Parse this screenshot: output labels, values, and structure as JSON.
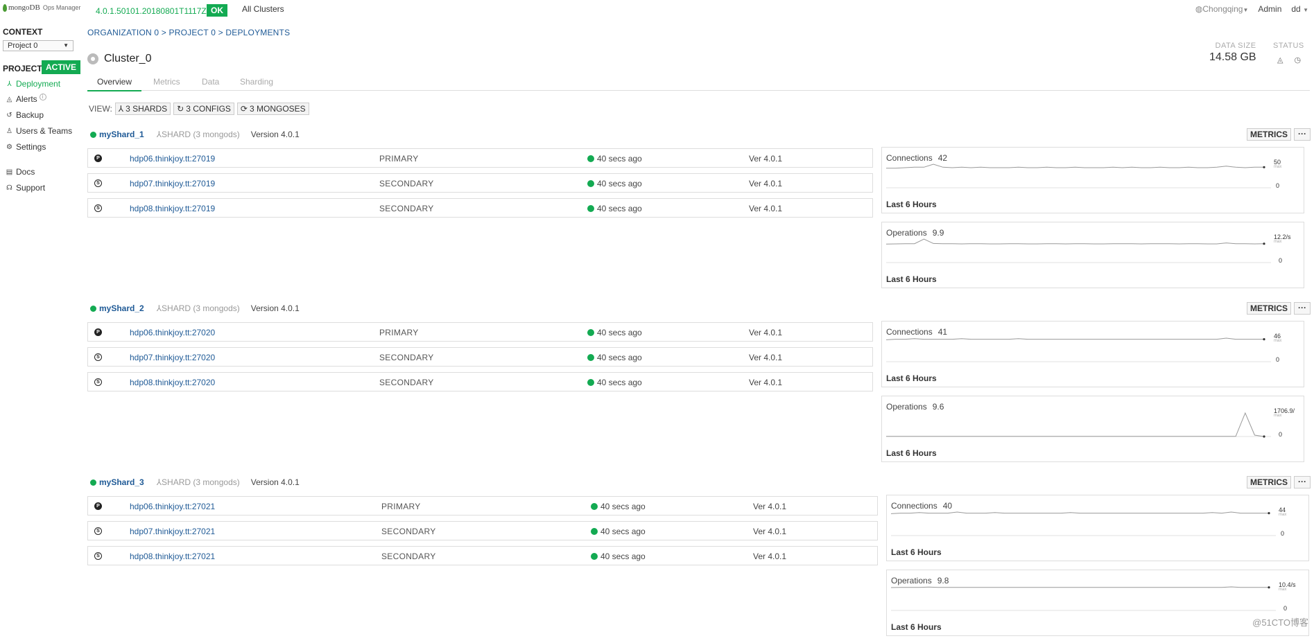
{
  "topbar": {
    "logo_brand": "mongoDB",
    "logo_product": "Ops Manager",
    "version": "4.0.1.50101.20180801T1117Z",
    "status": "OK",
    "all_clusters": "All Clusters",
    "location": "Chongqing",
    "admin": "Admin",
    "user": "dd"
  },
  "sidebar": {
    "context_label": "CONTEXT",
    "project_select": "Project 0",
    "project_label": "PROJECT",
    "project_status": "ACTIVE",
    "nav": [
      {
        "label": "Deployment",
        "icon": "deployment-icon",
        "glyph": "⅄"
      },
      {
        "label": "Alerts",
        "icon": "bell-icon",
        "glyph": "🔔"
      },
      {
        "label": "Backup",
        "icon": "backup-icon",
        "glyph": "↺"
      },
      {
        "label": "Users & Teams",
        "icon": "users-icon",
        "glyph": "♙"
      },
      {
        "label": "Settings",
        "icon": "gear-icon",
        "glyph": "⚙"
      },
      {
        "label": "Docs",
        "icon": "docs-icon",
        "glyph": "▤"
      },
      {
        "label": "Support",
        "icon": "support-icon",
        "glyph": "☊"
      }
    ]
  },
  "breadcrumb": "ORGANIZATION 0 > PROJECT 0 > DEPLOYMENTS",
  "cluster_name": "Cluster_0",
  "data_size_label": "DATA SIZE",
  "data_size": "14.58 GB",
  "status_label": "STATUS",
  "tabs": [
    "Overview",
    "Metrics",
    "Data",
    "Sharding"
  ],
  "view": {
    "label": "VIEW:",
    "shards": "3 SHARDS",
    "configs": "3 CONFIGS",
    "mongoses": "3 MONGOSES"
  },
  "metrics_label": "METRICS",
  "more_label": "···",
  "last_hours": "Last 6 Hours",
  "max_label": "max",
  "shards": [
    {
      "name": "myShard_1",
      "type": "SHARD (3 mongods)",
      "version": "Version 4.0.1",
      "processes": [
        {
          "role_letter": "P",
          "host": "hdp06.thinkjoy.tt:27019",
          "role": "PRIMARY",
          "ping": "40 secs ago",
          "ver": "Ver 4.0.1"
        },
        {
          "role_letter": "S",
          "host": "hdp07.thinkjoy.tt:27019",
          "role": "SECONDARY",
          "ping": "40 secs ago",
          "ver": "Ver 4.0.1"
        },
        {
          "role_letter": "S",
          "host": "hdp08.thinkjoy.tt:27019",
          "role": "SECONDARY",
          "ping": "40 secs ago",
          "ver": "Ver 4.0.1"
        }
      ],
      "charts": [
        {
          "title": "Connections",
          "value": "42",
          "max": "50",
          "zero": "0",
          "series": [
            40,
            40,
            41,
            42,
            42,
            48,
            42,
            41,
            42,
            41,
            42,
            41,
            41,
            41,
            42,
            41,
            41,
            42,
            41,
            41,
            42,
            41,
            41,
            41,
            42,
            41,
            42,
            41,
            41,
            42,
            41,
            41,
            42,
            41,
            41,
            42,
            44,
            42,
            41,
            42,
            42
          ]
        },
        {
          "title": "Operations",
          "value": "9.9",
          "max": "12.2/s",
          "zero": "0",
          "series": [
            9.6,
            9.7,
            9.8,
            9.8,
            12.2,
            9.9,
            9.8,
            9.8,
            9.7,
            9.8,
            9.8,
            9.7,
            9.7,
            9.8,
            9.8,
            9.7,
            9.7,
            9.8,
            9.8,
            9.7,
            9.8,
            9.8,
            9.7,
            9.7,
            9.8,
            9.8,
            9.8,
            9.7,
            9.8,
            9.8,
            9.8,
            9.7,
            9.8,
            9.8,
            9.7,
            9.7,
            10.2,
            9.8,
            9.8,
            9.7,
            9.8
          ]
        }
      ]
    },
    {
      "name": "myShard_2",
      "type": "SHARD (3 mongods)",
      "version": "Version 4.0.1",
      "processes": [
        {
          "role_letter": "P",
          "host": "hdp06.thinkjoy.tt:27020",
          "role": "PRIMARY",
          "ping": "40 secs ago",
          "ver": "Ver 4.0.1"
        },
        {
          "role_letter": "S",
          "host": "hdp07.thinkjoy.tt:27020",
          "role": "SECONDARY",
          "ping": "40 secs ago",
          "ver": "Ver 4.0.1"
        },
        {
          "role_letter": "S",
          "host": "hdp08.thinkjoy.tt:27020",
          "role": "SECONDARY",
          "ping": "40 secs ago",
          "ver": "Ver 4.0.1"
        }
      ],
      "charts": [
        {
          "title": "Connections",
          "value": "41",
          "max": "46",
          "zero": "0",
          "series": [
            40,
            41,
            41,
            42,
            41,
            41,
            41,
            41,
            42,
            41,
            41,
            41,
            41,
            41,
            42,
            41,
            41,
            41,
            41,
            41,
            41,
            41,
            41,
            41,
            41,
            41,
            41,
            41,
            41,
            41,
            41,
            41,
            41,
            41,
            41,
            41,
            43,
            41,
            41,
            41,
            41
          ]
        },
        {
          "title": "Operations",
          "value": "9.6",
          "max": "1706.9/",
          "zero": "0",
          "series": [
            9,
            9,
            9,
            9,
            9,
            9,
            9,
            9,
            9,
            9,
            9,
            9,
            9,
            9,
            9,
            9,
            9,
            9,
            9,
            9,
            9,
            9,
            9,
            9,
            9,
            9,
            9,
            9,
            9,
            9,
            9,
            9,
            9,
            9,
            9,
            9,
            9,
            9,
            1706.9,
            100,
            0
          ]
        }
      ]
    },
    {
      "name": "myShard_3",
      "type": "SHARD (3 mongods)",
      "version": "Version 4.0.1",
      "processes": [
        {
          "role_letter": "P",
          "host": "hdp06.thinkjoy.tt:27021",
          "role": "PRIMARY",
          "ping": "40 secs ago",
          "ver": "Ver 4.0.1"
        },
        {
          "role_letter": "S",
          "host": "hdp07.thinkjoy.tt:27021",
          "role": "SECONDARY",
          "ping": "40 secs ago",
          "ver": "Ver 4.0.1"
        },
        {
          "role_letter": "S",
          "host": "hdp08.thinkjoy.tt:27021",
          "role": "SECONDARY",
          "ping": "40 secs ago",
          "ver": "Ver 4.0.1"
        }
      ],
      "charts": [
        {
          "title": "Connections",
          "value": "40",
          "max": "44",
          "zero": "0",
          "series": [
            39,
            40,
            40,
            41,
            40,
            40,
            40,
            42,
            40,
            40,
            40,
            41,
            40,
            40,
            40,
            40,
            40,
            40,
            40,
            41,
            40,
            40,
            40,
            40,
            40,
            40,
            40,
            40,
            40,
            40,
            40,
            40,
            40,
            40,
            41,
            40,
            42,
            40,
            40,
            40,
            40
          ]
        },
        {
          "title": "Operations",
          "value": "9.8",
          "max": "10.4/s",
          "zero": "0",
          "series": [
            9.7,
            9.8,
            9.8,
            9.8,
            9.9,
            9.8,
            9.8,
            9.8,
            9.8,
            9.8,
            9.8,
            9.8,
            9.8,
            9.8,
            9.8,
            9.8,
            9.8,
            9.8,
            9.8,
            9.8,
            9.8,
            9.8,
            9.8,
            9.8,
            9.8,
            9.8,
            9.8,
            9.8,
            9.8,
            9.8,
            9.8,
            9.8,
            9.8,
            9.8,
            9.8,
            9.8,
            10.0,
            9.8,
            9.8,
            9.8,
            9.8
          ]
        }
      ]
    }
  ],
  "watermark": "@51CTO博客"
}
